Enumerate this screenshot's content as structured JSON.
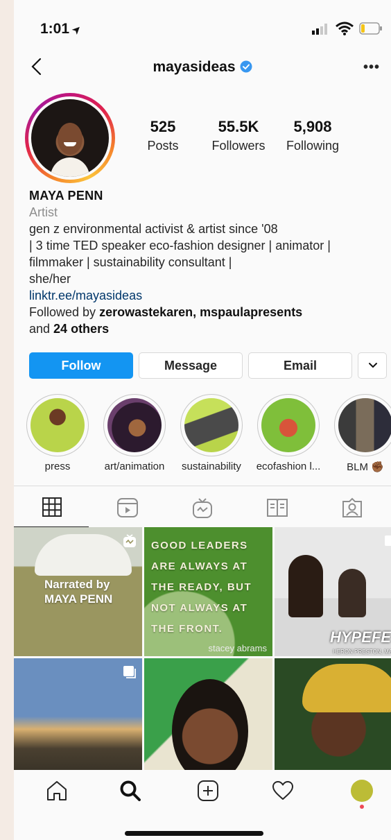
{
  "status_bar": {
    "time": "1:01"
  },
  "header": {
    "username": "mayasideas"
  },
  "profile": {
    "stats": {
      "posts": {
        "value": "525",
        "label": "Posts"
      },
      "followers": {
        "value": "55.5K",
        "label": "Followers"
      },
      "following": {
        "value": "5,908",
        "label": "Following"
      }
    },
    "name": "MAYA PENN",
    "category": "Artist",
    "bio_lines": [
      "gen z environmental activist & artist since '08",
      "| 3 time TED speaker eco-fashion designer | animator |",
      "filmmaker | sustainability consultant |",
      "she/her"
    ],
    "link": "linktr.ee/mayasideas",
    "followed_by": {
      "prefix": "Followed by ",
      "users": "zerowastekaren, mspaulapresents",
      "and": "and ",
      "others": "24 others"
    }
  },
  "actions": {
    "follow": "Follow",
    "message": "Message",
    "email": "Email"
  },
  "highlights": [
    {
      "label": "press"
    },
    {
      "label": "art/animation"
    },
    {
      "label": "sustainability"
    },
    {
      "label": "ecofashion l..."
    },
    {
      "label": "BLM ✊🏾"
    }
  ],
  "tabs": [
    "grid-icon",
    "reels-icon",
    "igtv-icon",
    "guides-icon",
    "tagged-icon"
  ],
  "grid": {
    "post1": {
      "line1": "Narrated by",
      "line2": "MAYA PENN"
    },
    "post2": {
      "lines": [
        "GOOD LEADERS",
        "ARE ALWAYS AT",
        "THE READY, BUT",
        "NOT ALWAYS AT",
        "THE FRONT."
      ],
      "credit": "stacey abrams"
    },
    "post3": {
      "title": "HYPEFE",
      "subtitle": "HERON PRESTON, MAY"
    }
  },
  "colors": {
    "accent_blue": "#1395f2",
    "link": "#00376b",
    "muted": "#8e8e8e",
    "notification_dot": "#ed4956"
  }
}
